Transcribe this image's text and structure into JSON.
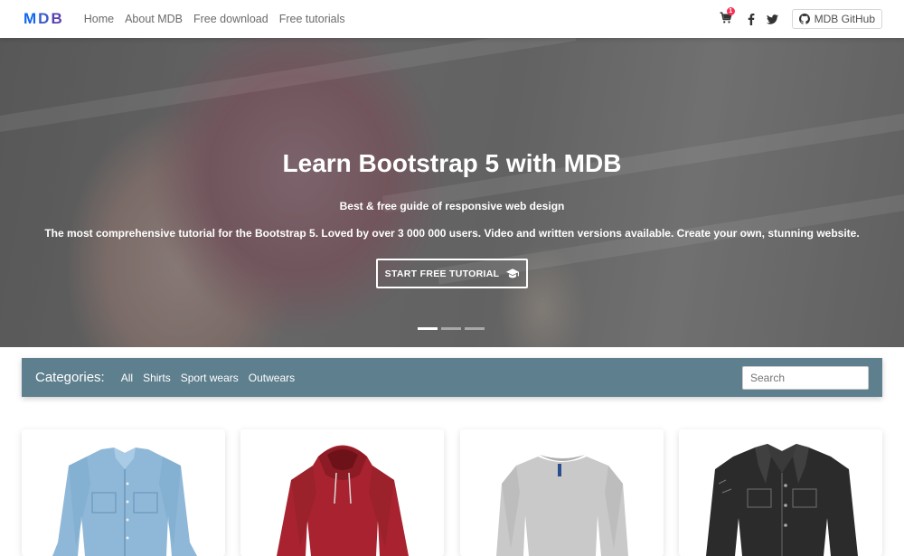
{
  "navbar": {
    "brand": "MDB",
    "links": [
      "Home",
      "About MDB",
      "Free download",
      "Free tutorials"
    ],
    "cart_count": "1",
    "github_label": "MDB GitHub"
  },
  "hero": {
    "title": "Learn Bootstrap 5 with MDB",
    "subtitle": "Best & free guide of responsive web design",
    "description": "The most comprehensive tutorial for the Bootstrap 5. Loved by over 3 000 000 users. Video and written versions available. Create your own, stunning website.",
    "button_label": "START FREE TUTORIAL",
    "slides": 3,
    "active_slide": 1
  },
  "categories": {
    "title": "Categories:",
    "items": [
      "All",
      "Shirts",
      "Sport wears",
      "Outwears"
    ],
    "search_placeholder": "Search"
  },
  "products": [
    {
      "item": "denim-shirt",
      "color": "#8fb8d8"
    },
    {
      "item": "red-hoodie",
      "color": "#a8232f"
    },
    {
      "item": "grey-sweatshirt",
      "color": "#c9c9c9"
    },
    {
      "item": "black-denim-jacket",
      "color": "#2b2b2b"
    }
  ],
  "colors": {
    "brand": "#1266f1",
    "category_bar": "#5e7f8e",
    "badge": "#f93154"
  }
}
